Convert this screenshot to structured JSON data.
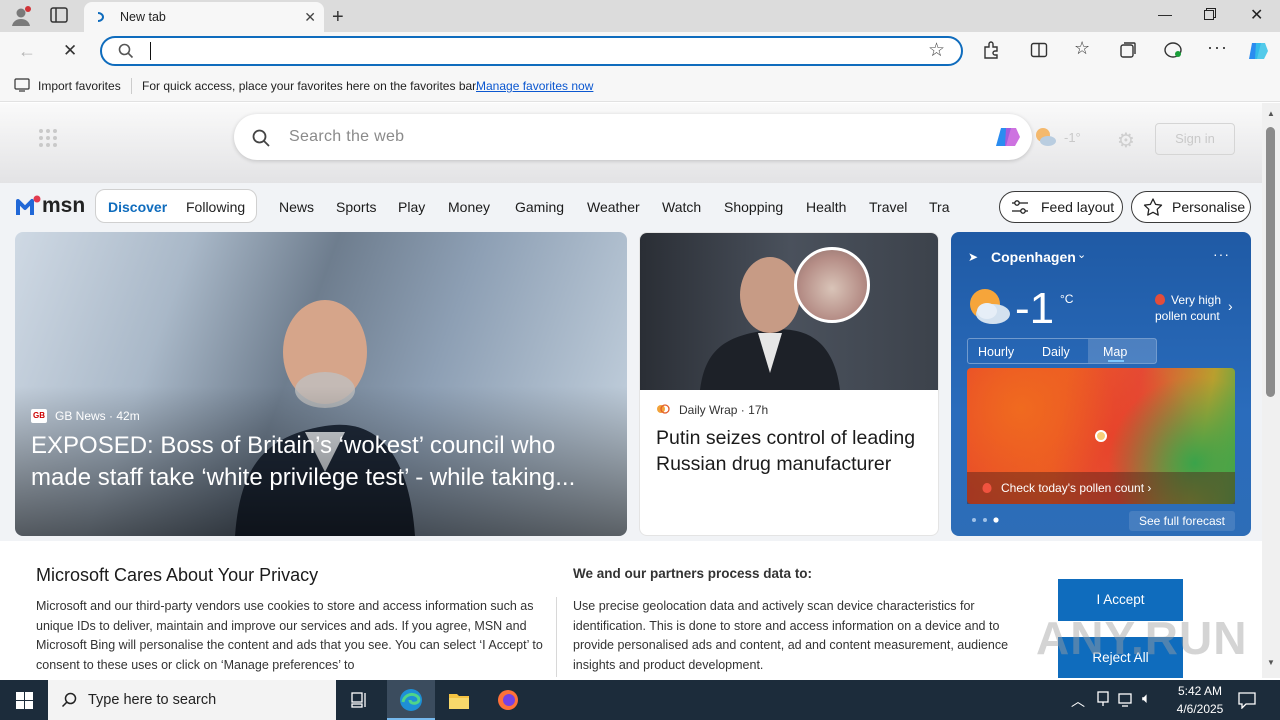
{
  "browser": {
    "tab_title": "New tab",
    "address_value": "",
    "favbar": {
      "import_label": "Import favorites",
      "message": "For quick access, place your favorites here on the favorites bar.",
      "manage_link": "Manage favorites now"
    }
  },
  "msn": {
    "search_placeholder": "Search the web",
    "weather_mini": "-1°",
    "sign_in": "Sign in",
    "logo_text": "msn",
    "pill": {
      "active": "Discover",
      "other": "Following"
    },
    "nav": [
      "News",
      "Sports",
      "Play",
      "Money",
      "Gaming",
      "Weather",
      "Watch",
      "Shopping",
      "Health",
      "Travel",
      "Tra"
    ],
    "feed_layout": "Feed layout",
    "personalise": "Personalise"
  },
  "cards": {
    "main": {
      "source": "GB News",
      "age": "42m",
      "headline": "EXPOSED: Boss of Britain’s ‘wokest’ council who made staff take ‘white privilege test’ - while taking..."
    },
    "second": {
      "source": "Daily Wrap",
      "age": "17h",
      "headline": "Putin seizes control of leading Russian drug manufacturer"
    }
  },
  "weather": {
    "city": "Copenhagen",
    "temp": "-1",
    "unit": "°C",
    "pollen_line1": "Very high",
    "pollen_line2": "pollen count",
    "tabs": [
      "Hourly",
      "Daily",
      "Map"
    ],
    "active_tab": "Map",
    "pollen_cta": "Check today's pollen count",
    "see_forecast": "See full forecast"
  },
  "privacy": {
    "title": "Microsoft Cares About Your Privacy",
    "body": "Microsoft and our third-party vendors use cookies to store and access information such as unique IDs to deliver, maintain and improve our services and ads. If you agree, MSN and Microsoft Bing will personalise the content and ads that you see. You can select ‘I Accept’ to consent to these uses or click on ‘Manage preferences’ to",
    "partners_title": "We and our partners process data to:",
    "partners_body": "Use precise geolocation data and actively scan device characteristics for identification. This is done to store and access information on a device and to provide personalised ads and content, ad and content measurement, audience insights and product development.",
    "accept": "I Accept",
    "reject": "Reject All"
  },
  "taskbar": {
    "search_placeholder": "Type here to search",
    "time": "5:42 AM",
    "date": "4/6/2025"
  },
  "watermark": "ANY.RUN",
  "colors": {
    "accent": "#0f6cbd",
    "taskbar": "#1c2c3b",
    "weather_card": "#2a6cbc"
  }
}
